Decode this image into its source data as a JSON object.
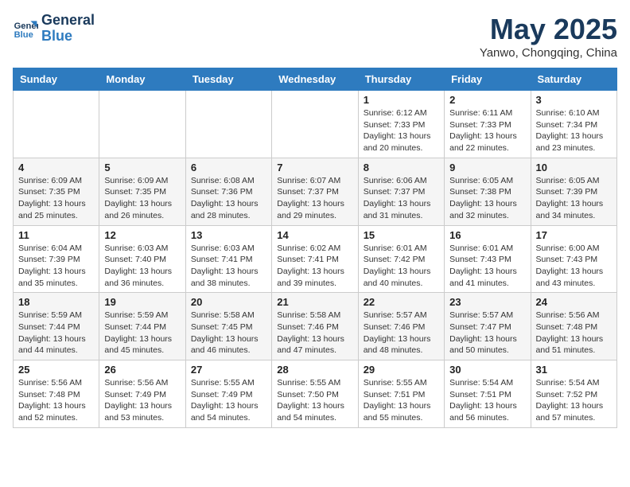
{
  "header": {
    "logo_line1": "General",
    "logo_line2": "Blue",
    "month": "May 2025",
    "location": "Yanwo, Chongqing, China"
  },
  "weekdays": [
    "Sunday",
    "Monday",
    "Tuesday",
    "Wednesday",
    "Thursday",
    "Friday",
    "Saturday"
  ],
  "weeks": [
    [
      {
        "day": "",
        "info": ""
      },
      {
        "day": "",
        "info": ""
      },
      {
        "day": "",
        "info": ""
      },
      {
        "day": "",
        "info": ""
      },
      {
        "day": "1",
        "info": "Sunrise: 6:12 AM\nSunset: 7:33 PM\nDaylight: 13 hours and 20 minutes."
      },
      {
        "day": "2",
        "info": "Sunrise: 6:11 AM\nSunset: 7:33 PM\nDaylight: 13 hours and 22 minutes."
      },
      {
        "day": "3",
        "info": "Sunrise: 6:10 AM\nSunset: 7:34 PM\nDaylight: 13 hours and 23 minutes."
      }
    ],
    [
      {
        "day": "4",
        "info": "Sunrise: 6:09 AM\nSunset: 7:35 PM\nDaylight: 13 hours and 25 minutes."
      },
      {
        "day": "5",
        "info": "Sunrise: 6:09 AM\nSunset: 7:35 PM\nDaylight: 13 hours and 26 minutes."
      },
      {
        "day": "6",
        "info": "Sunrise: 6:08 AM\nSunset: 7:36 PM\nDaylight: 13 hours and 28 minutes."
      },
      {
        "day": "7",
        "info": "Sunrise: 6:07 AM\nSunset: 7:37 PM\nDaylight: 13 hours and 29 minutes."
      },
      {
        "day": "8",
        "info": "Sunrise: 6:06 AM\nSunset: 7:37 PM\nDaylight: 13 hours and 31 minutes."
      },
      {
        "day": "9",
        "info": "Sunrise: 6:05 AM\nSunset: 7:38 PM\nDaylight: 13 hours and 32 minutes."
      },
      {
        "day": "10",
        "info": "Sunrise: 6:05 AM\nSunset: 7:39 PM\nDaylight: 13 hours and 34 minutes."
      }
    ],
    [
      {
        "day": "11",
        "info": "Sunrise: 6:04 AM\nSunset: 7:39 PM\nDaylight: 13 hours and 35 minutes."
      },
      {
        "day": "12",
        "info": "Sunrise: 6:03 AM\nSunset: 7:40 PM\nDaylight: 13 hours and 36 minutes."
      },
      {
        "day": "13",
        "info": "Sunrise: 6:03 AM\nSunset: 7:41 PM\nDaylight: 13 hours and 38 minutes."
      },
      {
        "day": "14",
        "info": "Sunrise: 6:02 AM\nSunset: 7:41 PM\nDaylight: 13 hours and 39 minutes."
      },
      {
        "day": "15",
        "info": "Sunrise: 6:01 AM\nSunset: 7:42 PM\nDaylight: 13 hours and 40 minutes."
      },
      {
        "day": "16",
        "info": "Sunrise: 6:01 AM\nSunset: 7:43 PM\nDaylight: 13 hours and 41 minutes."
      },
      {
        "day": "17",
        "info": "Sunrise: 6:00 AM\nSunset: 7:43 PM\nDaylight: 13 hours and 43 minutes."
      }
    ],
    [
      {
        "day": "18",
        "info": "Sunrise: 5:59 AM\nSunset: 7:44 PM\nDaylight: 13 hours and 44 minutes."
      },
      {
        "day": "19",
        "info": "Sunrise: 5:59 AM\nSunset: 7:44 PM\nDaylight: 13 hours and 45 minutes."
      },
      {
        "day": "20",
        "info": "Sunrise: 5:58 AM\nSunset: 7:45 PM\nDaylight: 13 hours and 46 minutes."
      },
      {
        "day": "21",
        "info": "Sunrise: 5:58 AM\nSunset: 7:46 PM\nDaylight: 13 hours and 47 minutes."
      },
      {
        "day": "22",
        "info": "Sunrise: 5:57 AM\nSunset: 7:46 PM\nDaylight: 13 hours and 48 minutes."
      },
      {
        "day": "23",
        "info": "Sunrise: 5:57 AM\nSunset: 7:47 PM\nDaylight: 13 hours and 50 minutes."
      },
      {
        "day": "24",
        "info": "Sunrise: 5:56 AM\nSunset: 7:48 PM\nDaylight: 13 hours and 51 minutes."
      }
    ],
    [
      {
        "day": "25",
        "info": "Sunrise: 5:56 AM\nSunset: 7:48 PM\nDaylight: 13 hours and 52 minutes."
      },
      {
        "day": "26",
        "info": "Sunrise: 5:56 AM\nSunset: 7:49 PM\nDaylight: 13 hours and 53 minutes."
      },
      {
        "day": "27",
        "info": "Sunrise: 5:55 AM\nSunset: 7:49 PM\nDaylight: 13 hours and 54 minutes."
      },
      {
        "day": "28",
        "info": "Sunrise: 5:55 AM\nSunset: 7:50 PM\nDaylight: 13 hours and 54 minutes."
      },
      {
        "day": "29",
        "info": "Sunrise: 5:55 AM\nSunset: 7:51 PM\nDaylight: 13 hours and 55 minutes."
      },
      {
        "day": "30",
        "info": "Sunrise: 5:54 AM\nSunset: 7:51 PM\nDaylight: 13 hours and 56 minutes."
      },
      {
        "day": "31",
        "info": "Sunrise: 5:54 AM\nSunset: 7:52 PM\nDaylight: 13 hours and 57 minutes."
      }
    ]
  ]
}
